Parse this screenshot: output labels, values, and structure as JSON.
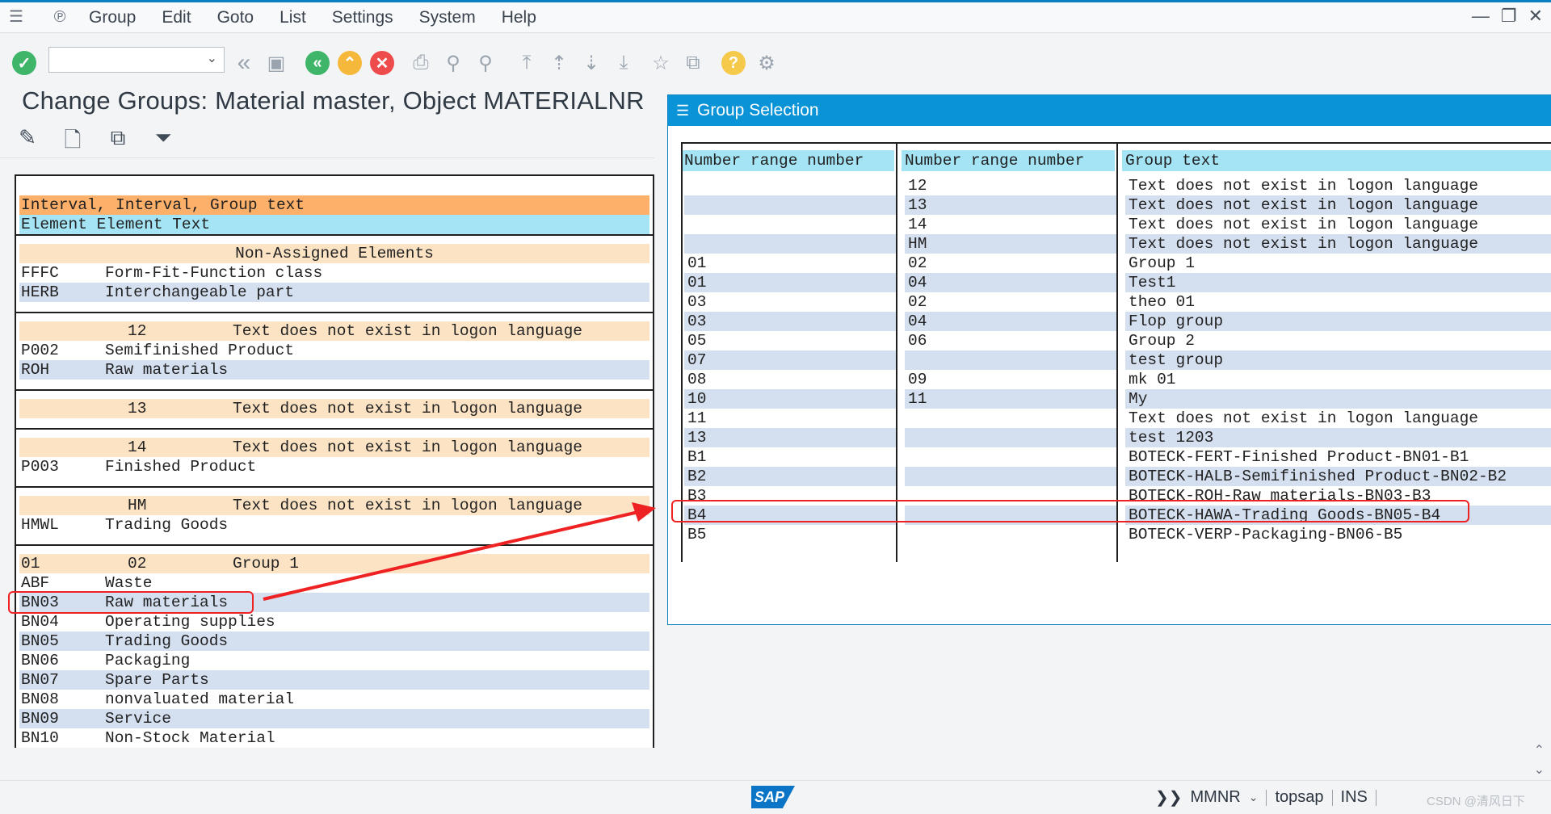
{
  "window": {
    "menu": [
      "Group",
      "Edit",
      "Goto",
      "List",
      "Settings",
      "System",
      "Help"
    ],
    "controls": [
      "—",
      "❐",
      "✕"
    ]
  },
  "toolbar": {
    "command_field_value": "",
    "colors": {
      "ok": "#3fb56a",
      "nav": "#3fb56a",
      "up": "#f5b83a",
      "cancel": "#ee4c4c",
      "help": "#f5c94a"
    }
  },
  "page": {
    "title": "Change Groups: Material master, Object MATERIALNR"
  },
  "left_list": {
    "header": {
      "line1": "Interval, Interval, Group text",
      "line2": "Element Element Text"
    },
    "sections": [
      {
        "heading": "Non-Assigned Elements",
        "rows": [
          {
            "element": "FFFC",
            "text": "Form-Fit-Function class"
          },
          {
            "element": "HERB",
            "text": "Interchangeable part"
          }
        ]
      },
      {
        "heading_from": "",
        "heading_to": "12",
        "heading_text": "Text does not exist in logon language",
        "rows": [
          {
            "element": "P002",
            "text": "Semifinished Product"
          },
          {
            "element": "ROH",
            "text": "Raw materials"
          }
        ]
      },
      {
        "heading_from": "",
        "heading_to": "13",
        "heading_text": "Text does not exist in logon language",
        "rows": []
      },
      {
        "heading_from": "",
        "heading_to": "14",
        "heading_text": "Text does not exist in logon language",
        "rows": [
          {
            "element": "P003",
            "text": "Finished Product"
          }
        ]
      },
      {
        "heading_from": "",
        "heading_to": "HM",
        "heading_text": "Text does not exist in logon language",
        "rows": [
          {
            "element": "HMWL",
            "text": "Trading Goods"
          }
        ]
      },
      {
        "heading_from": "01",
        "heading_to": "02",
        "heading_text": "Group 1",
        "rows": [
          {
            "element": "ABF",
            "text": "Waste"
          },
          {
            "element": "BN03",
            "text": "Raw materials"
          },
          {
            "element": "BN04",
            "text": "Operating supplies"
          },
          {
            "element": "BN05",
            "text": "Trading Goods"
          },
          {
            "element": "BN06",
            "text": "Packaging"
          },
          {
            "element": "BN07",
            "text": "Spare Parts"
          },
          {
            "element": "BN08",
            "text": "nonvaluated material"
          },
          {
            "element": "BN09",
            "text": "Service"
          },
          {
            "element": "BN10",
            "text": "Non-Stock Material"
          }
        ]
      }
    ]
  },
  "dialog": {
    "title": "Group Selection",
    "columns": [
      "Number range number",
      "Number range number",
      "Group text"
    ],
    "rows": [
      [
        "",
        "12",
        "Text does not exist in logon language"
      ],
      [
        "",
        "13",
        "Text does not exist in logon language"
      ],
      [
        "",
        "14",
        "Text does not exist in logon language"
      ],
      [
        "",
        "HM",
        "Text does not exist in logon language"
      ],
      [
        "01",
        "02",
        "Group 1"
      ],
      [
        "01",
        "04",
        "Test1"
      ],
      [
        "03",
        "02",
        "theo 01"
      ],
      [
        "03",
        "04",
        "Flop group"
      ],
      [
        "05",
        "06",
        "Group 2"
      ],
      [
        "07",
        "",
        "test group"
      ],
      [
        "08",
        "09",
        "mk 01"
      ],
      [
        "10",
        "11",
        "My"
      ],
      [
        "11",
        "",
        "Text does not exist in logon language"
      ],
      [
        "13",
        "",
        "test 1203"
      ],
      [
        "B1",
        "",
        "BOTECK-FERT-Finished Product-BN01-B1"
      ],
      [
        "B2",
        "",
        "BOTECK-HALB-Semifinished Product-BN02-B2"
      ],
      [
        "B3",
        "",
        "BOTECK-ROH-Raw materials-BN03-B3"
      ],
      [
        "B4",
        "",
        "BOTECK-HAWA-Trading Goods-BN05-B4"
      ],
      [
        "B5",
        "",
        "BOTECK-VERP-Packaging-BN06-B5"
      ]
    ]
  },
  "statusbar": {
    "logo": "SAP",
    "expand": "❯❯",
    "system": "MMNR",
    "server": "topsap",
    "mode": "INS",
    "watermark": "CSDN @清风日下"
  }
}
